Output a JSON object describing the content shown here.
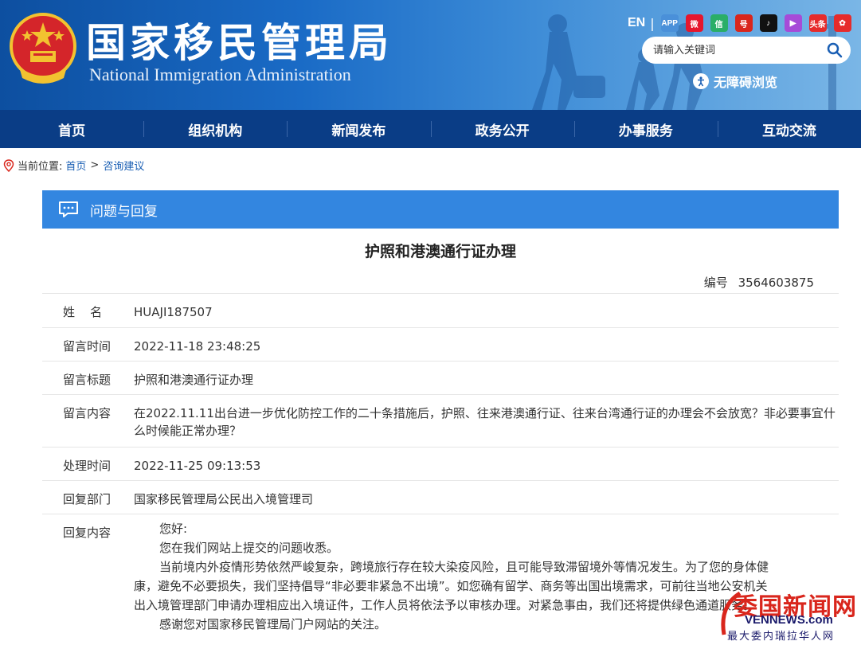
{
  "header": {
    "title_cn": "国家移民管理局",
    "title_en": "National Immigration Administration",
    "lang_link": "EN",
    "social_icons": [
      {
        "name": "app-icon",
        "glyph": "APP",
        "color": "#4a90d9"
      },
      {
        "name": "weibo-icon",
        "glyph": "微",
        "color": "#e6162d"
      },
      {
        "name": "wechat-icon",
        "glyph": "信",
        "color": "#2aae67"
      },
      {
        "name": "toutiao-hao-icon",
        "glyph": "号",
        "color": "#d9261c"
      },
      {
        "name": "douyin-icon",
        "glyph": "♪",
        "color": "#111111"
      },
      {
        "name": "kuaishou-icon",
        "glyph": "▶",
        "color": "#a64bd8"
      },
      {
        "name": "toutiao-icon",
        "glyph": "头条",
        "color": "#e62b2b"
      },
      {
        "name": "other-app-icon",
        "glyph": "✿",
        "color": "#e62b2b"
      }
    ],
    "search_placeholder": "请输入关键词",
    "accessibility_label": "无障碍浏览"
  },
  "nav": {
    "items": [
      "首页",
      "组织机构",
      "新闻发布",
      "政务公开",
      "办事服务",
      "互动交流"
    ]
  },
  "breadcrumb": {
    "prefix": "当前位置:",
    "home": "首页",
    "separator": ">",
    "current": "咨询建议"
  },
  "panel": {
    "heading": "问题与回复",
    "title": "护照和港澳通行证办理",
    "number_label": "编号",
    "number": "3564603875",
    "fields": {
      "name_label": "姓    名",
      "name": "HUAJI187507",
      "time_label": "留言时间",
      "time": "2022-11-18 23:48:25",
      "subject_label": "留言标题",
      "subject": "护照和港澳通行证办理",
      "content_label": "留言内容",
      "content": "在2022.11.11出台进一步优化防控工作的二十条措施后，护照、往来港澳通行证、往来台湾通行证的办理会不会放宽？非必要事宜什么时候能正常办理？",
      "handle_time_label": "处理时间",
      "handle_time": "2022-11-25 09:13:53",
      "dept_label": "回复部门",
      "dept": "国家移民管理局公民出入境管理司",
      "reply_label": "回复内容",
      "reply_lines": [
        "您好:",
        "您在我们网站上提交的问题收悉。",
        "当前境内外疫情形势依然严峻复杂，跨境旅行存在较大染疫风险，且可能导致滞留境外等情况发生。为了您的身体健",
        "康，避免不必要损失，我们坚持倡导“非必要非紧急不出境”。如您确有留学、商务等出国出境需求，可前往当地公安机关",
        "出入境管理部门申请办理相应出入境证件，工作人员将依法予以审核办理。对紧急事由，我们还将提供绿色通道服务。",
        "感谢您对国家移民管理局门户网站的关注。"
      ]
    }
  },
  "watermark": {
    "title": "委国新闻网",
    "url": "VENNEWS.com",
    "subtitle": "最大委内瑞拉华人网"
  }
}
